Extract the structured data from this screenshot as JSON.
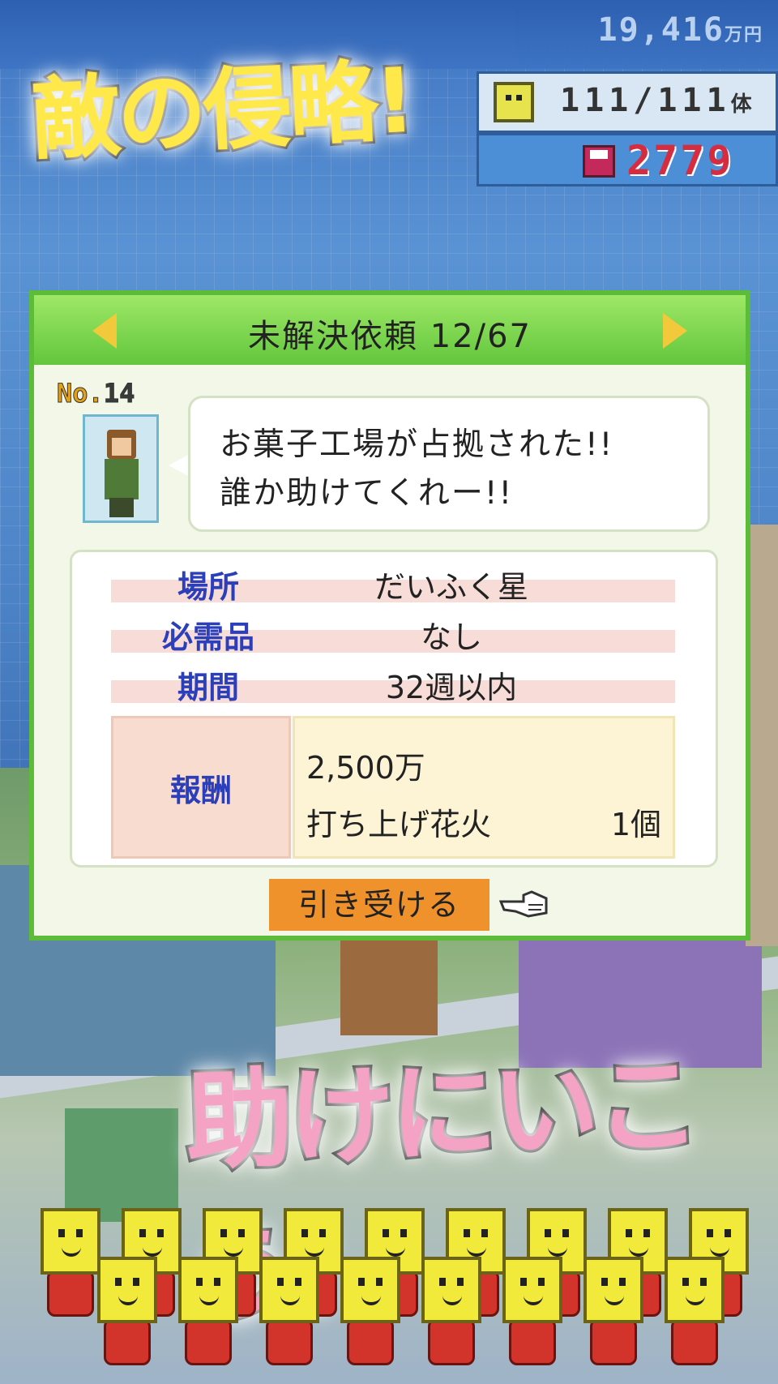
{
  "hud": {
    "money_value": "19,416",
    "money_unit": "万円",
    "population_value": "111/111",
    "population_unit": "体",
    "score_value": "2779"
  },
  "banners": {
    "top": "敵の侵略!",
    "bottom": "助けにいこう!"
  },
  "dialog": {
    "title": "未解決依頼 12/67",
    "no_prefix": "No.",
    "no_value": "14",
    "speech_line1": "お菓子工場が占拠された!!",
    "speech_line2": "誰か助けてくれー!!",
    "rows": [
      {
        "key": "場所",
        "value": "だいふく星"
      },
      {
        "key": "必需品",
        "value": "なし"
      },
      {
        "key": "期間",
        "value": "32週以内"
      }
    ],
    "reward_key": "報酬",
    "reward_line1": "2,500万",
    "reward_item": "打ち上げ花火",
    "reward_qty": "1個",
    "accept_label": "引き受ける"
  },
  "colors": {
    "dialog_border": "#5dbb3a",
    "key_text": "#2c3fbb",
    "accept_button": "#f0922c",
    "score_text": "#d62c3f"
  }
}
